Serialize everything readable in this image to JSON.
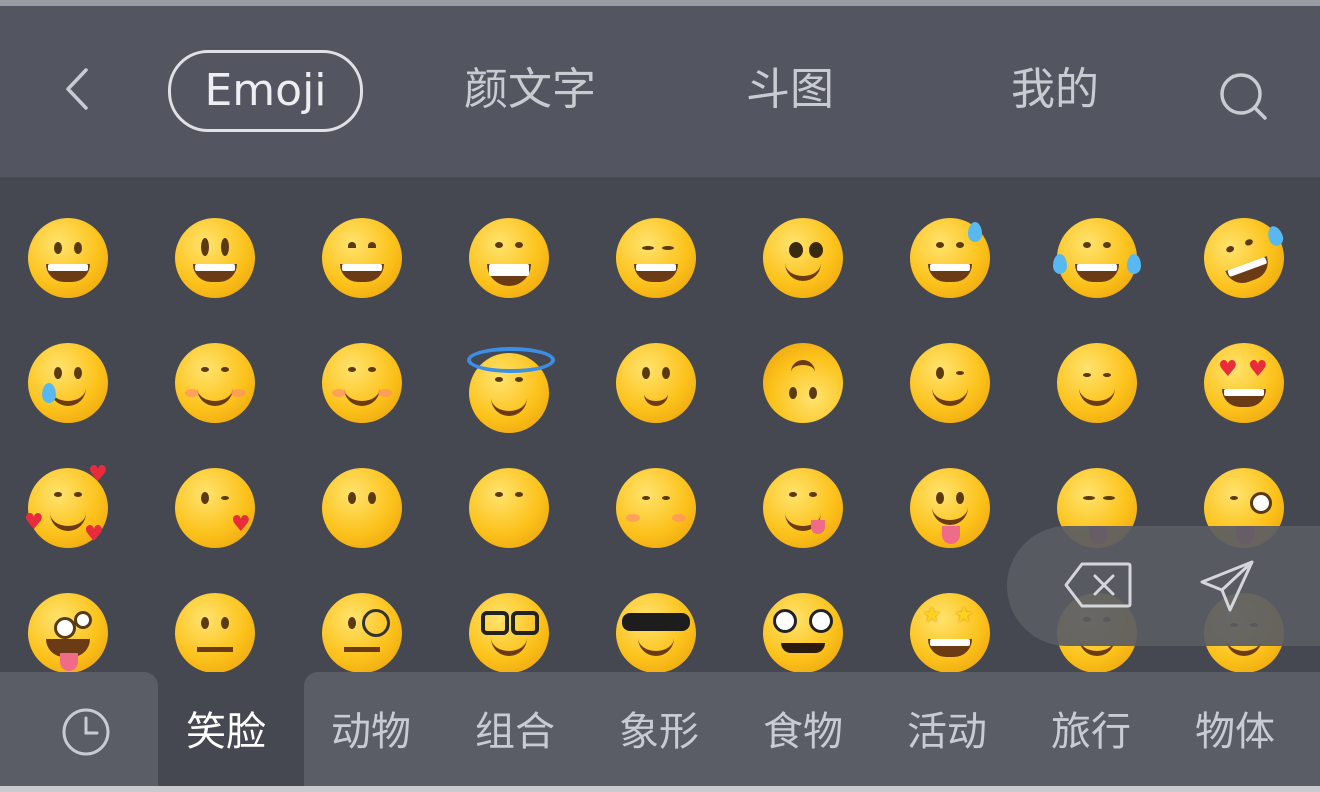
{
  "header": {
    "tabs": [
      {
        "label": "Emoji",
        "selected": true
      },
      {
        "label": "颜文字",
        "selected": false
      },
      {
        "label": "斗图",
        "selected": false
      },
      {
        "label": "我的",
        "selected": false
      }
    ],
    "back_icon": "chevron-left-icon",
    "search_icon": "search-icon"
  },
  "emoji_grid": {
    "rows": [
      [
        "grinning-face",
        "grinning-face-big-eyes",
        "grinning-face-smiling-eyes",
        "beaming-face",
        "grinning-squinting-face",
        "face-holding-back-tears",
        "grinning-face-sweat",
        "face-with-tears-of-joy",
        "rolling-on-floor-laughing"
      ],
      [
        "smiling-face-with-tear",
        "smiling-face",
        "smiling-face-smiling-eyes",
        "smiling-face-halo",
        "slightly-smiling-face",
        "upside-down-face",
        "winking-face",
        "relieved-face",
        "smiling-face-heart-eyes"
      ],
      [
        "smiling-face-hearts",
        "face-blowing-kiss",
        "kissing-face",
        "kissing-face-smiling-eyes",
        "kissing-face-closed-eyes",
        "face-savoring-food",
        "face-with-tongue",
        "squinting-face-tongue",
        "winking-face-tongue"
      ],
      [
        "zany-face",
        "face-raised-eyebrow",
        "face-monocle",
        "nerd-face",
        "smiling-face-sunglasses",
        "disguised-face",
        "star-struck",
        "partying-face",
        "smiling-face-closed-eyes"
      ]
    ]
  },
  "floating_actions": {
    "delete_icon": "backspace-icon",
    "send_icon": "send-icon"
  },
  "categories": {
    "recent_icon": "clock-icon",
    "items": [
      {
        "label": "笑脸",
        "selected": true
      },
      {
        "label": "动物",
        "selected": false
      },
      {
        "label": "组合",
        "selected": false
      },
      {
        "label": "象形",
        "selected": false
      },
      {
        "label": "食物",
        "selected": false
      },
      {
        "label": "活动",
        "selected": false
      },
      {
        "label": "旅行",
        "selected": false
      },
      {
        "label": "物体",
        "selected": false
      }
    ]
  },
  "colors": {
    "header_bg": "#535560",
    "grid_bg": "#464851",
    "tab_bar_bg": "#5a5c66",
    "text": "#c9cbd2",
    "emoji_yellow": "#fcc21b"
  }
}
